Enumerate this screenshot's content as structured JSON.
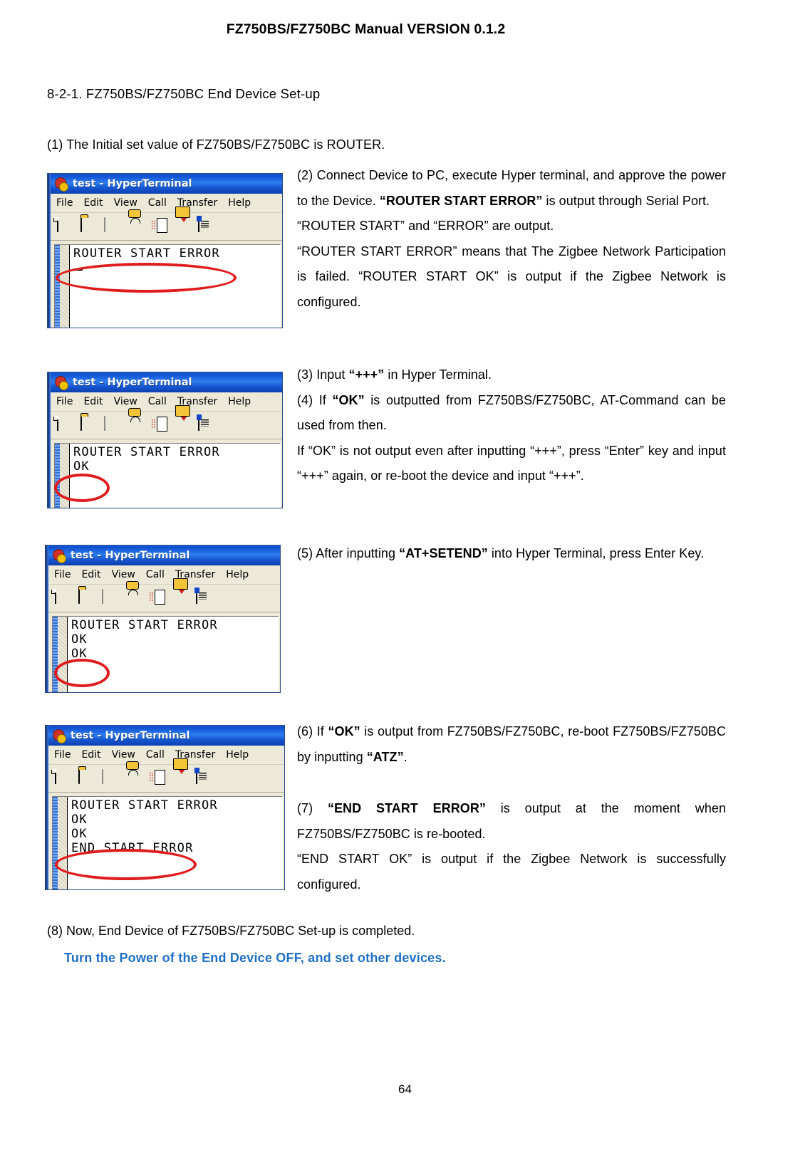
{
  "header": {
    "title": "FZ750BS/FZ750BC Manual VERSION 0.1.2"
  },
  "section": {
    "heading": "8-2-1. FZ750BS/FZ750BC End Device Set-up",
    "intro": "(1) The Initial set value of FZ750BS/FZ750BC is ROUTER."
  },
  "body": {
    "step2_p1_a": "(2) Connect Device to PC, execute Hyper terminal, and approve the power to the Device. ",
    "step2_p1_b": "“ROUTER START ERROR”",
    "step2_p1_c": " is output through Serial Port.",
    "step2_p2": "“ROUTER START” and “ERROR” are output.",
    "step2_p3": "“ROUTER START ERROR” means that The Zigbee Network Participation is failed. “ROUTER START OK” is output if the Zigbee Network is configured.",
    "step3_a": "(3) Input ",
    "step3_b": "“+++”",
    "step3_c": " in Hyper Terminal.",
    "step4_a": "(4) If ",
    "step4_b": "“OK”",
    "step4_c": " is outputted from FZ750BS/FZ750BC, AT-Command can be used from then.",
    "step4_p2": "If “OK” is not output even after inputting “+++”, press “Enter” key and input “+++” again, or re-boot the device and input “+++”.",
    "step5_a": "(5) After inputting ",
    "step5_b": "“AT+SETEND”",
    "step5_c": " into Hyper Terminal, press Enter Key.",
    "step6_a": "(6) If ",
    "step6_b": "“OK”",
    "step6_c": " is output from FZ750BS/FZ750BC, re-boot FZ750BS/FZ750BC by inputting ",
    "step6_d": "“ATZ”",
    "step6_e": ".",
    "step7_a": "(7) ",
    "step7_b": "“END START ERROR”",
    "step7_c": " is output at the moment when FZ750BS/FZ750BC is re-booted.",
    "step7_p2": "“END START OK” is output if the Zigbee Network is successfully configured.",
    "step8": "(8) Now, End Device of FZ750BS/FZ750BC Set-up is completed.",
    "note": "Turn the Power of the End Device OFF, and set other devices."
  },
  "footer": {
    "page_number": "64"
  },
  "terminal_window": {
    "title": "test - HyperTerminal",
    "menu": [
      "File",
      "Edit",
      "View",
      "Call",
      "Transfer",
      "Help"
    ],
    "toolbar_icons": [
      "new-connection-icon",
      "open-folder-icon",
      "disconnect-phone-icon",
      "connect-phone-icon",
      "send-file-icon",
      "receive-file-icon",
      "properties-icon"
    ]
  },
  "screenshots": [
    {
      "id": "shot-1",
      "lines": [
        "ROUTER START ERROR"
      ],
      "has_caret": true,
      "annotation": "ellipse-around-router-start-error"
    },
    {
      "id": "shot-2",
      "lines": [
        "ROUTER START ERROR",
        "OK"
      ],
      "has_caret": false,
      "annotation": "ellipse-around-ok"
    },
    {
      "id": "shot-3",
      "lines": [
        "ROUTER START ERROR",
        "OK",
        "OK"
      ],
      "has_caret": false,
      "annotation": "ellipse-around-second-ok"
    },
    {
      "id": "shot-4",
      "lines": [
        "ROUTER START ERROR",
        "OK",
        "OK",
        "END START ERROR"
      ],
      "has_caret": false,
      "annotation": "ellipse-around-end-start-error"
    }
  ],
  "colors": {
    "annotation_red": "#e01b1b",
    "note_blue": "#1f6fc4",
    "titlebar_blue": "#1655cf"
  }
}
